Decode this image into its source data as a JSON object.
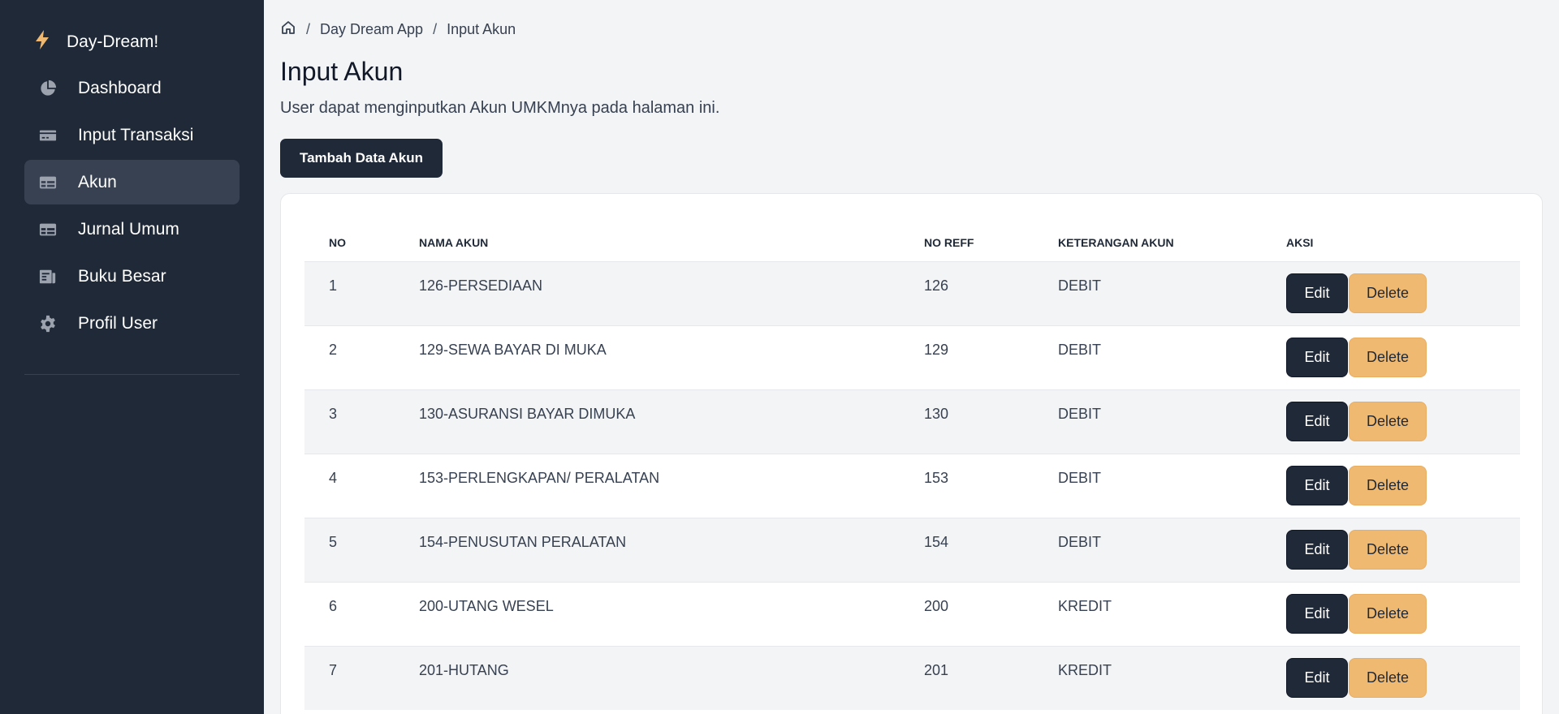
{
  "app": {
    "brand": "Day-Dream!",
    "brand_icon": "bolt-icon",
    "accent_color": "#f0b971",
    "sidebar_color": "#1f2937"
  },
  "sidebar": {
    "items": [
      {
        "label": "Dashboard",
        "icon": "chart-pie-icon",
        "active": false
      },
      {
        "label": "Input Transaksi",
        "icon": "credit-card-icon",
        "active": false
      },
      {
        "label": "Akun",
        "icon": "table-icon",
        "active": true
      },
      {
        "label": "Jurnal Umum",
        "icon": "table-icon",
        "active": false
      },
      {
        "label": "Buku Besar",
        "icon": "ledger-icon",
        "active": false
      },
      {
        "label": "Profil User",
        "icon": "gear-icon",
        "active": false
      }
    ]
  },
  "breadcrumb": {
    "home_icon": "home-icon",
    "items": [
      "Day Dream App",
      "Input Akun"
    ],
    "separator": "/"
  },
  "page": {
    "title": "Input Akun",
    "subtitle": "User dapat menginputkan Akun UMKMnya pada halaman ini.",
    "add_button": "Tambah Data Akun"
  },
  "table": {
    "headers": [
      "NO",
      "NAMA AKUN",
      "NO REFF",
      "KETERANGAN AKUN",
      "AKSI"
    ],
    "edit_label": "Edit",
    "delete_label": "Delete",
    "rows": [
      {
        "no": "1",
        "nama": "126-PERSEDIAAN",
        "reff": "126",
        "ket": "DEBIT"
      },
      {
        "no": "2",
        "nama": "129-SEWA BAYAR DI MUKA",
        "reff": "129",
        "ket": "DEBIT"
      },
      {
        "no": "3",
        "nama": "130-ASURANSI BAYAR DIMUKA",
        "reff": "130",
        "ket": "DEBIT"
      },
      {
        "no": "4",
        "nama": "153-PERLENGKAPAN/ PERALATAN",
        "reff": "153",
        "ket": "DEBIT"
      },
      {
        "no": "5",
        "nama": "154-PENUSUTAN PERALATAN",
        "reff": "154",
        "ket": "DEBIT"
      },
      {
        "no": "6",
        "nama": "200-UTANG WESEL",
        "reff": "200",
        "ket": "KREDIT"
      },
      {
        "no": "7",
        "nama": "201-HUTANG",
        "reff": "201",
        "ket": "KREDIT"
      }
    ]
  }
}
